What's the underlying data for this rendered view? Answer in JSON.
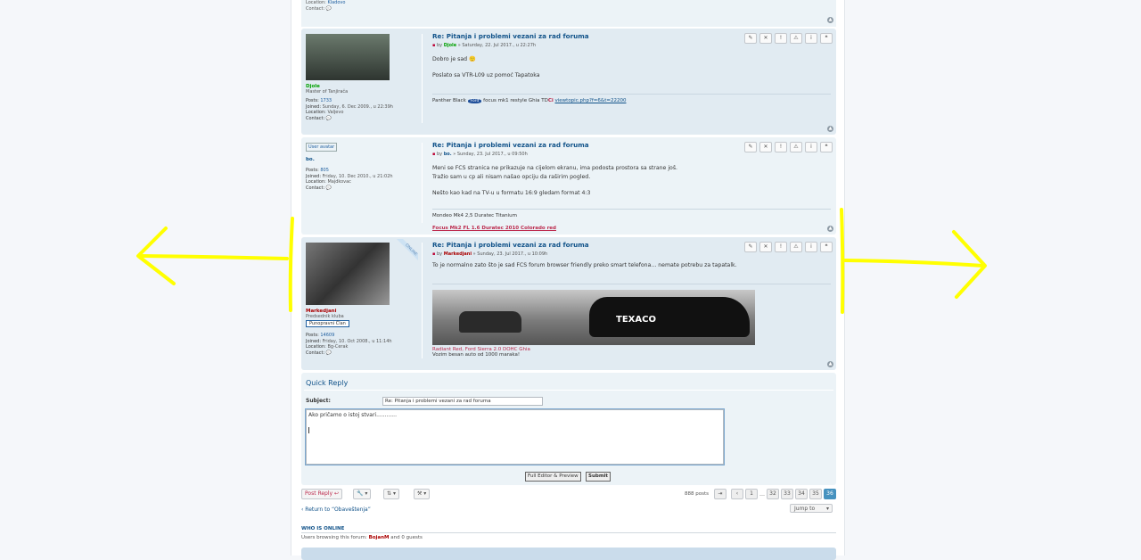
{
  "prev_post": {
    "location_label": "Location:",
    "location": "Kladovo",
    "contact_label": "Contact:"
  },
  "posts": [
    {
      "title": "Re: Pitanja i problemi vezani za rad foruma",
      "by": "by",
      "author": "Djole",
      "date": "» Saturday, 22. Jul 2017., u 22:27h",
      "username": "Djole",
      "rank": "Master of Tanjirača",
      "posts_label": "Posts:",
      "posts": "1733",
      "joined_label": "Joined:",
      "joined": "Sunday, 6. Dec 2009., u 22:39h",
      "location_label": "Location:",
      "location": "Valjevo",
      "contact_label": "Contact:",
      "content": [
        "Dobro je sad 🙂",
        "Poslato sa VTR-L09 uz pomoć Tapatoka"
      ],
      "sig_text": "Panther Black",
      "sig_brand": "Ford",
      "sig_model": "focus mk1 restyle Ghia TD",
      "sig_ci": "Ci",
      "sig_link": "viewtopic.php?f=6&t=22200"
    },
    {
      "title": "Re: Pitanja i problemi vezani za rad foruma",
      "by": "by",
      "author": "bo.",
      "date": "» Sunday, 23. Jul 2017., u 09:50h",
      "avatar_alt": "User avatar",
      "username": "bo.",
      "posts_label": "Posts:",
      "posts": "805",
      "joined_label": "Joined:",
      "joined": "Friday, 10. Dec 2010., u 21:02h",
      "location_label": "Location:",
      "location": "Majdkovac",
      "contact_label": "Contact:",
      "content": [
        "Meni se FCS stranica ne prikazuje na cijelom ekranu, ima podosta prostora sa strane još.",
        "Tražio sam u cp ali nisam našao opciju da raširim pogled.",
        "Nešto kao kad na TV-u u formatu 16:9 gledam format 4:3"
      ],
      "sig_text": "Mondeo Mk4 2,5 Duratec Titanium",
      "sig_red": "Focus Mk2 FL 1.6 Duratec 2010 Colorado red"
    },
    {
      "title": "Re: Pitanja i problemi vezani za rad foruma",
      "by": "by",
      "author": "Markedjani",
      "date": "» Sunday, 23. Jul 2017., u 10:09h",
      "online": "ONLINE",
      "username": "Markedjani",
      "rank": "Predsednik kluba",
      "rank_badge": "Punopravni Član",
      "posts_label": "Posts:",
      "posts": "14609",
      "joined_label": "Joined:",
      "joined": "Friday, 10. Oct 2008., u 11:14h",
      "location_label": "Location:",
      "location": "Bg-Cerak",
      "contact_label": "Contact:",
      "content": [
        "To je normalno zato što je sad FCS forum browser friendly preko smart telefona... nemate potrebu za tapatalk."
      ],
      "banner_text": "TEXACO",
      "sig_red": "Radiant Red, Ford Sierra 2.0 DOHC Ghia",
      "sig_text": "Vozim besan auto od 1000 maraka!"
    }
  ],
  "quick_reply": {
    "heading": "Quick Reply",
    "subject_label": "Subject:",
    "subject_value": "Re: Pitanja i problemi vezani za rad foruma",
    "message": "Ako pričamo o istoj stvari............",
    "full_editor": "Full Editor & Preview",
    "submit": "Submit"
  },
  "actions": {
    "post_reply": "Post Reply",
    "post_count": "888 posts",
    "pages": [
      "1",
      "…",
      "32",
      "33",
      "34",
      "35",
      "36"
    ],
    "current_page": "36",
    "return": "‹ Return to “Obaveštenja”",
    "jump_to": "Jump to"
  },
  "who": {
    "heading": "WHO IS ONLINE",
    "text": "Users browsing this forum:",
    "user": "BojanM",
    "tail": "and 0 guests"
  },
  "colors": {
    "annotation": "#ffff00",
    "link": "#105289",
    "post_bg": "#e1ebf2",
    "accent": "#4692bf"
  }
}
